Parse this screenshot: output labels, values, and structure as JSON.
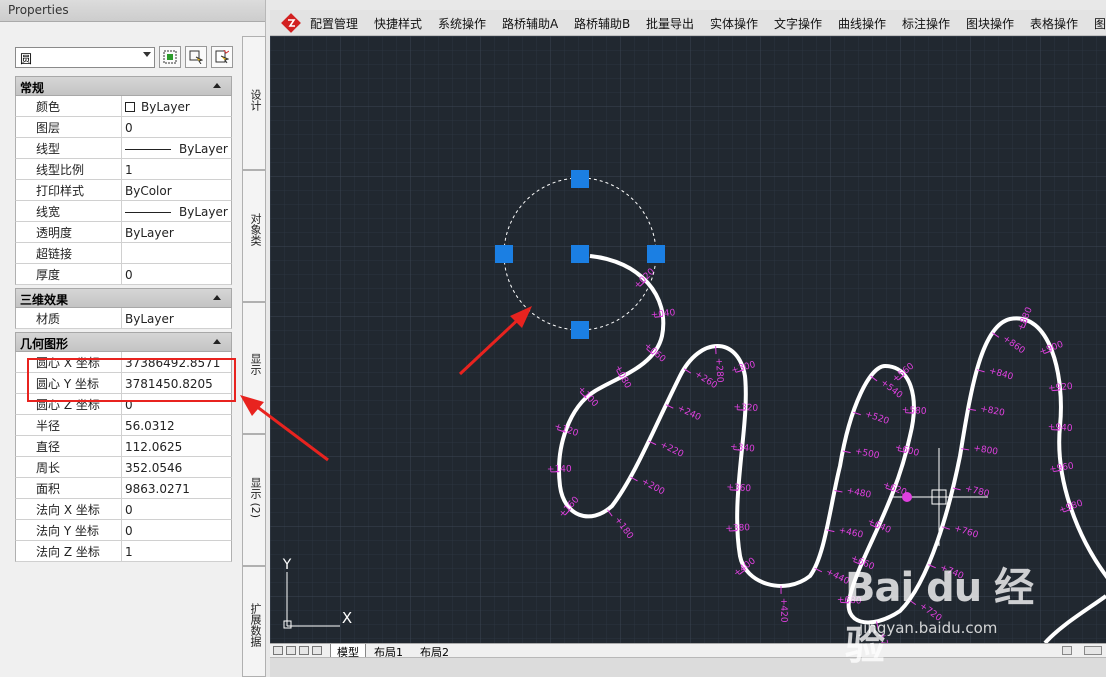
{
  "properties_panel": {
    "title": "Properties",
    "object_type": "圆",
    "sections": {
      "general": {
        "title": "常规",
        "rows": [
          {
            "name": "颜色",
            "value": "ByLayer"
          },
          {
            "name": "图层",
            "value": "0"
          },
          {
            "name": "线型",
            "value": "ByLayer"
          },
          {
            "name": "线型比例",
            "value": "1"
          },
          {
            "name": "打印样式",
            "value": "ByColor"
          },
          {
            "name": "线宽",
            "value": "ByLayer"
          },
          {
            "name": "透明度",
            "value": "ByLayer"
          },
          {
            "name": "超链接",
            "value": ""
          },
          {
            "name": "厚度",
            "value": "0"
          }
        ]
      },
      "three_d": {
        "title": "三维效果",
        "rows": [
          {
            "name": "材质",
            "value": "ByLayer"
          }
        ]
      },
      "geometry": {
        "title": "几何图形",
        "rows": [
          {
            "name": "圆心 X 坐标",
            "value": "37386492.8571"
          },
          {
            "name": "圆心 Y 坐标",
            "value": "3781450.8205"
          },
          {
            "name": "圆心 Z 坐标",
            "value": "0"
          },
          {
            "name": "半径",
            "value": "56.0312"
          },
          {
            "name": "直径",
            "value": "112.0625"
          },
          {
            "name": "周长",
            "value": "352.0546"
          },
          {
            "name": "面积",
            "value": "9863.0271"
          },
          {
            "name": "法向 X 坐标",
            "value": "0"
          },
          {
            "name": "法向 Y 坐标",
            "value": "0"
          },
          {
            "name": "法向 Z 坐标",
            "value": "1"
          }
        ]
      }
    },
    "side_tabs": [
      "设计",
      "对象类",
      "显示",
      "显示 (2)",
      "扩展数据"
    ]
  },
  "menubar": {
    "items": [
      "配置管理",
      "快捷样式",
      "系统操作",
      "路桥辅助A",
      "路桥辅助B",
      "批量导出",
      "实体操作",
      "文字操作",
      "曲线操作",
      "标注操作",
      "图块操作",
      "表格操作",
      "图"
    ]
  },
  "layout_tabs": [
    "模型",
    "布局1",
    "布局2"
  ],
  "ucs_axis": {
    "x": "X",
    "y": "Y"
  },
  "watermark": {
    "brand": "Bai du 经验",
    "url": "jingyan.baidu.com"
  },
  "colors": {
    "canvas_bg": "#212830",
    "grip": "#1b7fe3",
    "station_labels": "#e040e0",
    "highlight": "#e8231f"
  },
  "stations": [
    "+020",
    "+040",
    "+060",
    "+080",
    "+100",
    "+120",
    "+140",
    "+160",
    "+180",
    "+200",
    "+220",
    "+240",
    "+260",
    "+280",
    "+300",
    "+320",
    "+340",
    "+360",
    "+380",
    "+400",
    "+420",
    "+440",
    "+460",
    "+480",
    "+500",
    "+520",
    "+540",
    "+560",
    "+580",
    "+600",
    "+620",
    "+640",
    "+660",
    "+680",
    "+700",
    "+720",
    "+740",
    "+760",
    "+780",
    "+800",
    "+820",
    "+840",
    "+860",
    "+880",
    "+900",
    "+920",
    "+940",
    "+960",
    "+980"
  ]
}
